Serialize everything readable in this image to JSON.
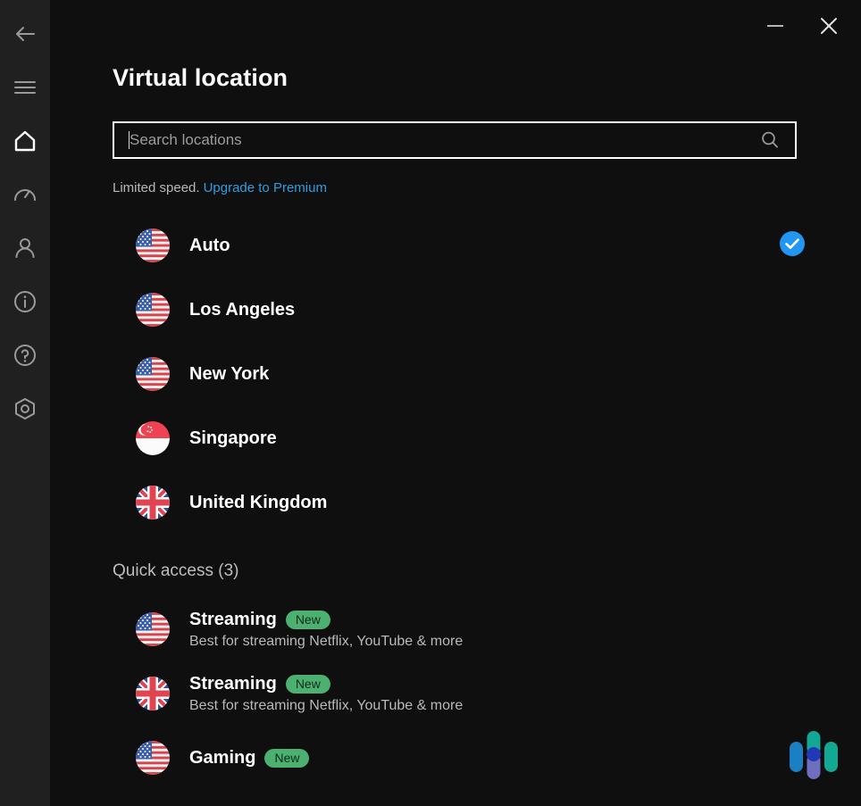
{
  "window": {
    "minimize_label": "Minimize",
    "close_label": "Close"
  },
  "sidebar": {
    "items": [
      {
        "id": "back",
        "icon": "back-arrow-icon",
        "label": "Back",
        "active": false
      },
      {
        "id": "menu",
        "icon": "hamburger-menu-icon",
        "label": "Menu",
        "active": false
      },
      {
        "id": "home",
        "icon": "home-icon",
        "label": "Home",
        "active": true
      },
      {
        "id": "speed",
        "icon": "speedometer-icon",
        "label": "Speed test",
        "active": false
      },
      {
        "id": "account",
        "icon": "person-icon",
        "label": "Account",
        "active": false
      },
      {
        "id": "info",
        "icon": "info-circle-icon",
        "label": "Info",
        "active": false
      },
      {
        "id": "help",
        "icon": "question-circle-icon",
        "label": "Help",
        "active": false
      },
      {
        "id": "settings",
        "icon": "settings-hex-icon",
        "label": "Settings",
        "active": false
      }
    ]
  },
  "header": {
    "title": "Virtual location"
  },
  "search": {
    "placeholder": "Search locations",
    "value": "",
    "icon": "search-icon"
  },
  "notice": {
    "text": "Limited speed.",
    "link": "Upgrade to Premium",
    "link_color": "#2f9de0"
  },
  "locations": [
    {
      "name": "Auto",
      "flag": "us",
      "selected": true
    },
    {
      "name": "Los Angeles",
      "flag": "us",
      "selected": false
    },
    {
      "name": "New York",
      "flag": "us",
      "selected": false
    },
    {
      "name": "Singapore",
      "flag": "sg",
      "selected": false
    },
    {
      "name": "United Kingdom",
      "flag": "gb",
      "selected": false
    }
  ],
  "quick_access": {
    "title": "Quick access (3)",
    "items": [
      {
        "name": "Streaming",
        "badge": "New",
        "subtitle": "Best for streaming Netflix, YouTube & more",
        "flag": "us"
      },
      {
        "name": "Streaming",
        "badge": "New",
        "subtitle": "Best for streaming Netflix, YouTube & more",
        "flag": "gb"
      },
      {
        "name": "Gaming",
        "badge": "New",
        "subtitle": "",
        "flag": "us"
      }
    ]
  },
  "brand": {
    "logo_name": "app-brand-logo",
    "colors": {
      "bar_left": "#1b7fc4",
      "bar_mid_top": "#13a893",
      "bar_mid_bottom": "#6f6fc0",
      "bar_right": "#13a893",
      "dot": "#2338b8"
    }
  },
  "theme": {
    "sidebar_bg": "#202020",
    "main_bg": "#0f0f0f",
    "accent_blue": "#2196f3",
    "badge_green": "#4cb071"
  }
}
